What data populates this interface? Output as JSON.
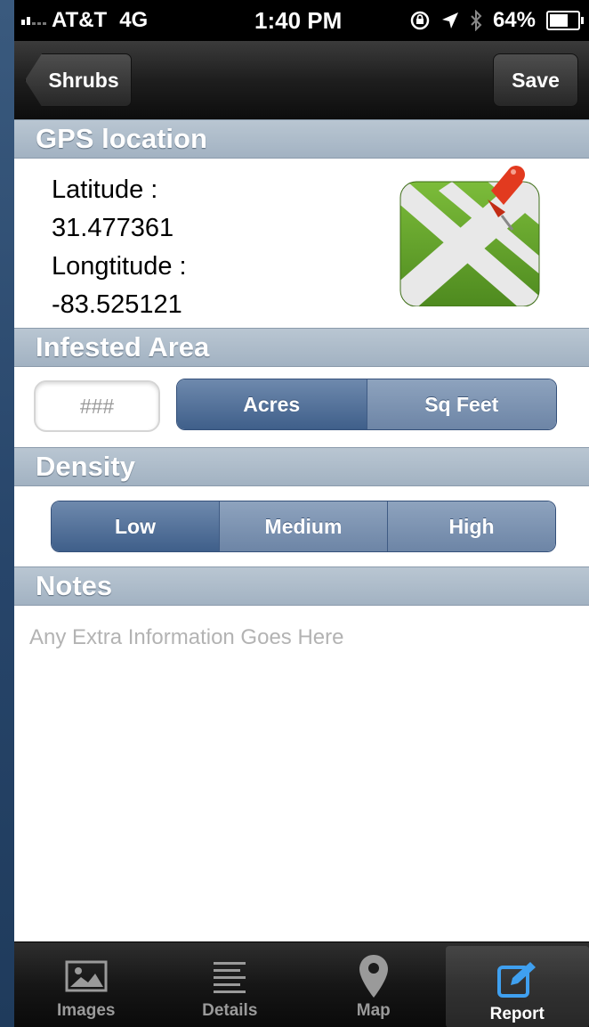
{
  "status_bar": {
    "carrier": "AT&T",
    "network": "4G",
    "time": "1:40 PM",
    "battery": "64%"
  },
  "nav": {
    "back_label": "Shrubs",
    "save_label": "Save"
  },
  "gps": {
    "header": "GPS location",
    "latitude_label": "Latitude :",
    "latitude_value": "31.477361",
    "longitude_label": "Longtitude :",
    "longitude_value": "-83.525121",
    "icon": "map-pin-icon"
  },
  "infested_area": {
    "header": "Infested Area",
    "input_placeholder": "###",
    "units": [
      "Acres",
      "Sq Feet"
    ],
    "selected_unit": "Acres"
  },
  "density": {
    "header": "Density",
    "options": [
      "Low",
      "Medium",
      "High"
    ],
    "selected": "Low"
  },
  "notes": {
    "header": "Notes",
    "placeholder": "Any Extra Information Goes Here"
  },
  "tabs": [
    {
      "label": "Images",
      "icon": "image-icon"
    },
    {
      "label": "Details",
      "icon": "list-icon"
    },
    {
      "label": "Map",
      "icon": "map-pin-icon"
    },
    {
      "label": "Report",
      "icon": "edit-icon"
    }
  ],
  "active_tab": "Report",
  "colors": {
    "segment_selected": "#4a6a94",
    "section_header": "#aebccb",
    "map_green": "#5f9a2a",
    "pin_red": "#e23a1f",
    "report_icon": "#3fa0f0"
  }
}
